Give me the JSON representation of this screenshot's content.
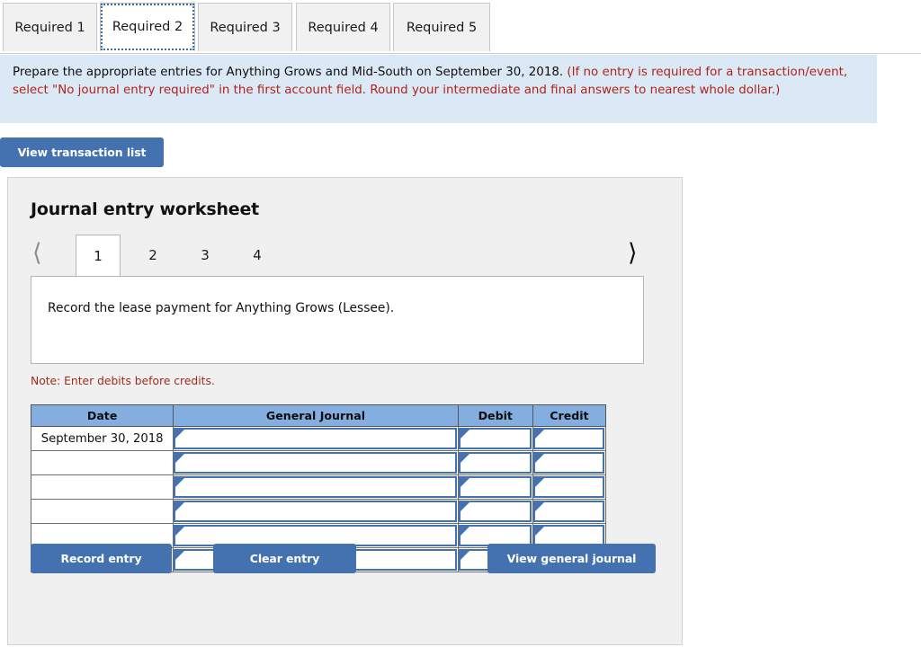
{
  "required_tabs": [
    {
      "label": "Required 1",
      "active": false
    },
    {
      "label": "Required 2",
      "active": true
    },
    {
      "label": "Required 3",
      "active": false
    },
    {
      "label": "Required 4",
      "active": false
    },
    {
      "label": "Required 5",
      "active": false
    }
  ],
  "instructions": {
    "black_text": "Prepare the appropriate entries for Anything Grows and Mid-South on September 30, 2018. ",
    "red_text": "(If no entry is required for a transaction/event, select \"No journal entry required\" in the first account field. Round your intermediate and final answers to nearest whole dollar.)"
  },
  "toolbar": {
    "view_transaction_list_label": "View transaction list"
  },
  "worksheet": {
    "title": "Journal entry worksheet",
    "prev_icon": "chevron-left-icon",
    "next_icon": "chevron-right-icon",
    "pages": [
      {
        "label": "1",
        "active": true
      },
      {
        "label": "2",
        "active": false
      },
      {
        "label": "3",
        "active": false
      },
      {
        "label": "4",
        "active": false
      }
    ],
    "description": "Record the lease payment for Anything Grows (Lessee).",
    "note": "Note: Enter debits before credits."
  },
  "journal_table": {
    "headers": [
      "Date",
      "General Journal",
      "Debit",
      "Credit"
    ],
    "rows": [
      {
        "date": "September 30, 2018",
        "general_journal": "",
        "debit": "",
        "credit": ""
      },
      {
        "date": "",
        "general_journal": "",
        "debit": "",
        "credit": ""
      },
      {
        "date": "",
        "general_journal": "",
        "debit": "",
        "credit": ""
      },
      {
        "date": "",
        "general_journal": "",
        "debit": "",
        "credit": ""
      },
      {
        "date": "",
        "general_journal": "",
        "debit": "",
        "credit": ""
      },
      {
        "date": "",
        "general_journal": "",
        "debit": "",
        "credit": ""
      }
    ]
  },
  "actions": {
    "record_entry_label": "Record entry",
    "clear_entry_label": "Clear entry",
    "view_general_journal_label": "View general journal"
  },
  "colors": {
    "button_blue": "#4472b0",
    "table_header_blue": "#85aee0",
    "banner_blue": "#dbe9f7",
    "panel_gray": "#f0f0f0",
    "note_red": "#9e2a20",
    "instruction_red": "#b02318"
  }
}
